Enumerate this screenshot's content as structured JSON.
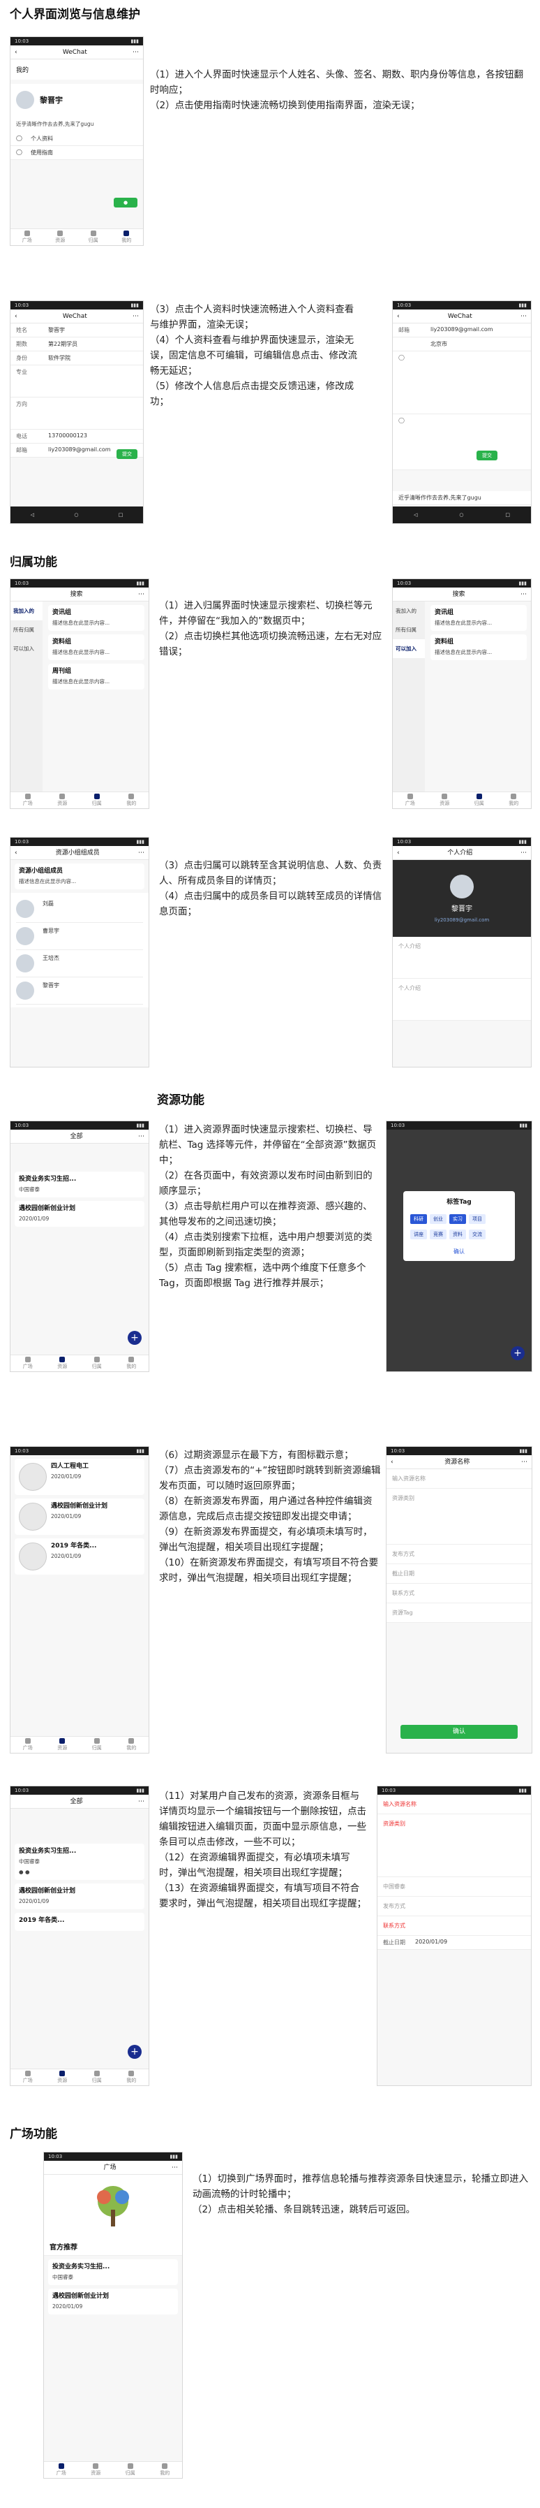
{
  "sections": {
    "personal": "个人界面浏览与信息维护",
    "group": "归属功能",
    "resource": "资源功能",
    "square": "广场功能"
  },
  "paragraphs": {
    "p1": [
      "（1）进入个人界面时快速显示个人姓名、头像、签名、期数、职内身份等信息，各按钮翻时响应；",
      "（2）点击使用指南时快速流畅切换到使用指南界面，渲染无误；"
    ],
    "p2": [
      "（3）点击个人资料时快速流畅进入个人资料查看与维护界面，渲染无误；",
      "（4）个人资料查看与维护界面快速显示，渲染无误，固定信息不可编辑，可编辑信息点击、修改流畅无延迟；",
      "（5）修改个人信息后点击提交反馈迅速，修改成功；"
    ],
    "p3": [
      "（1）进入归属界面时快速显示搜索栏、切换栏等元件，并停留在“我加入的”数据页中；",
      "（2）点击切换栏其他选项切换流畅迅速，左右无对应错误；"
    ],
    "p4": [
      "（3）点击归属可以跳转至含其说明信息、人数、负责人、所有成员条目的详情页；",
      "（4）点击归属中的成员条目可以跳转至成员的详情信息页面；"
    ],
    "p5": [
      "（1）进入资源界面时快速显示搜索栏、切换栏、导航栏、Tag 选择等元件，并停留在“全部资源”数据页中；",
      "（2）在各页面中，有效资源以发布时间由新到旧的顺序显示；",
      "（3）点击导航栏用户可以在推荐资源、感兴趣的、其他导发布的之间迅速切换；",
      "（4）点击类别搜索下拉框，选中用户想要浏览的类型，页面即刷新到指定类型的资源；",
      "（5）点击 Tag 搜索框，选中两个维度下任意多个 Tag，页面即根据 Tag 进行推荐并展示；"
    ],
    "p6": [
      "（6）过期资源显示在最下方，有图标戳示意；",
      "（7）点击资源发布的“+”按钮即时跳转到新资源编辑发布页面，可以随时返回原界面；",
      "（8）在新资源发布界面，用户通过各种控件编辑资源信息，完成后点击提交按钮即发出提交申请；",
      "（9）在新资源发布界面提交，有必填项未填写时，弹出气泡提醒，相关项目出现红字提醒；",
      "（10）在新资源发布界面提交，有填写项目不符合要求时，弹出气泡提醒，相关项目出现红字提醒；"
    ],
    "p7": [
      "（11）对某用户自己发布的资源，资源条目框与详情页均显示一个编辑按钮与一个删除按钮，点击编辑按钮进入编辑页面，页面中显示原信息，一些条目可以点击修改，一些不可以；",
      "（12）在资源编辑界面提交，有必填项未填写时，弹出气泡提醒，相关项目出现红字提醒；",
      "（13）在资源编辑界面提交，有填写项目不符合要求时，弹出气泡提醒，相关项目出现红字提醒；"
    ],
    "p8": [
      "（1）切换到广场界面时，推荐信息轮播与推荐资源条目快速显示，轮播立即进入动画流畅的计时轮播中；",
      "（2）点击相关轮播、条目跳转迅速，跳转后可返回。"
    ]
  },
  "phones": {
    "wechat": "WeChat",
    "me": "我的",
    "name": "黎晋宇",
    "sign": "近乎清晰作作去去养,先来了gugu",
    "menu1": "个人资料",
    "menu2": "使用指南",
    "labels": [
      "姓名",
      "期数",
      "身份",
      "专业",
      "方向",
      "电话",
      "邮箱"
    ],
    "values": [
      "黎晋宇",
      "第22期学员",
      "软件学院",
      "",
      "",
      "13700000123",
      "liy203089@gmail.com"
    ],
    "submit": "提交",
    "city": "北京市",
    "email2": "liy203089@gmail.com",
    "search": "搜索",
    "tabs": [
      "我加入的",
      "全部",
      "可加入"
    ],
    "sideItems": [
      "我加入的",
      "所有归属",
      "可以加入"
    ],
    "groupCards": [
      {
        "t": "资讯组",
        "d": "描述信息在此显示内容..."
      },
      {
        "t": "资料组",
        "d": "描述信息在此显示内容..."
      },
      {
        "t": "周刊组",
        "d": "描述信息在此显示内容..."
      }
    ],
    "groupTitle": "资源小组组成员",
    "members": [
      "刘磊",
      "曹思宇",
      "王培杰",
      "黎晋宇"
    ],
    "personTitle": "个人介绍",
    "resTitle": "全部",
    "tagTitle": "标签Tag",
    "tags": [
      "科研",
      "创业",
      "实习",
      "项目",
      "讲座",
      "竞赛",
      "资料",
      "交流"
    ],
    "res1": "投资业务实习生招...",
    "res2": "遇校园创新创业计划",
    "res3": "四人工程电工",
    "res4": "2019 年各类...",
    "company": "中国睿泰",
    "resForm": [
      "资源名称",
      "输入资源名称",
      "资源类别",
      "发布方式",
      "截止日期",
      "联系方式",
      "资源Tag"
    ],
    "confirm": "确认",
    "date": "2020/01/09",
    "squareTab": "官方推荐",
    "nav": [
      "广场",
      "资源",
      "归属",
      "我的"
    ]
  }
}
